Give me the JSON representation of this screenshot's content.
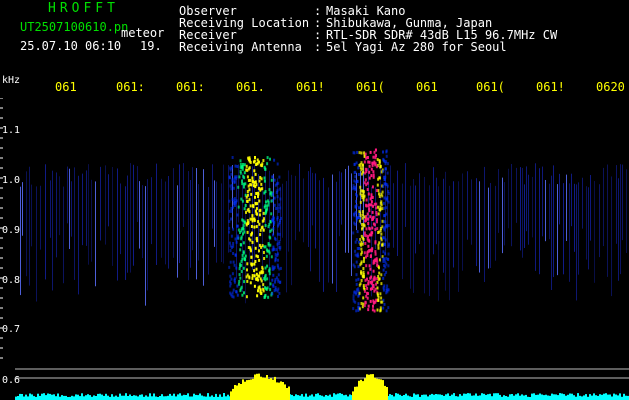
{
  "header": {
    "brand": "HROFFT",
    "filename": "UT2507100610.pn",
    "event_type": "meteor",
    "datetime": "25.07.10 06:10",
    "count": "19."
  },
  "station": {
    "rows": [
      {
        "label": "Observer",
        "value": "Masaki Kano"
      },
      {
        "label": "Receiving Location",
        "value": "Shibukawa, Gunma, Japan"
      },
      {
        "label": "Receiver",
        "value": "RTL-SDR SDR# 43dB L15 96.7MHz CW"
      },
      {
        "label": "Receiving Antenna",
        "value": "5el Yagi Az 280 for Seoul"
      }
    ]
  },
  "axis": {
    "unit": "kHz",
    "time_ticks": [
      "061",
      "061:",
      "061:",
      "061.",
      "061!",
      "061(",
      "061",
      "061(",
      "061!",
      "0620"
    ],
    "freq_ticks": [
      "1.1",
      "1.0",
      "0.9",
      "0.8",
      "0.7",
      "0.6"
    ]
  },
  "colors": {
    "signal_low": "#0030ff",
    "signal_mid": "#00ff80",
    "signal_high": "#ffff00",
    "signal_peak": "#ff1a80",
    "amplitude_fill": "#ffff00",
    "noise_floor": "#00ffff"
  }
}
